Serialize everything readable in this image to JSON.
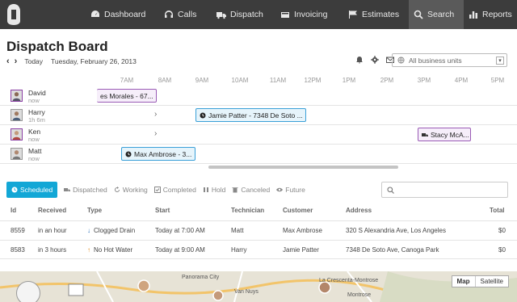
{
  "nav": {
    "items": [
      {
        "label": "Dashboard",
        "icon": "dashboard-icon"
      },
      {
        "label": "Calls",
        "icon": "headset-icon"
      },
      {
        "label": "Dispatch",
        "icon": "truck-icon"
      },
      {
        "label": "Invoicing",
        "icon": "invoice-icon"
      },
      {
        "label": "Estimates",
        "icon": "flag-icon"
      },
      {
        "label": "Search",
        "icon": "search-icon"
      },
      {
        "label": "Reports",
        "icon": "reports-icon"
      }
    ],
    "active": "Search"
  },
  "page": {
    "title": "Dispatch Board",
    "today_label": "Today",
    "date": "Tuesday, February 26, 2013",
    "business_units_placeholder": "All business units"
  },
  "timeline": {
    "hours": [
      "7AM",
      "8AM",
      "9AM",
      "10AM",
      "11AM",
      "12PM",
      "1PM",
      "2PM",
      "3PM",
      "4PM",
      "5PM"
    ],
    "technicians": [
      {
        "name": "David",
        "sub": "now",
        "selected": true,
        "jobs": [
          {
            "text": "es Morales - 67...",
            "color": "purple"
          }
        ]
      },
      {
        "name": "Harry",
        "sub": "1h 6m",
        "selected": false,
        "jobs": [
          {
            "text": "Jamie Patter - 7348 De Soto ...",
            "color": "blue"
          }
        ]
      },
      {
        "name": "Ken",
        "sub": "now",
        "selected": true,
        "jobs": [
          {
            "text": "Stacy McA...",
            "color": "purple"
          }
        ]
      },
      {
        "name": "Matt",
        "sub": "now",
        "selected": false,
        "jobs": [
          {
            "text": "Max Ambrose - 3...",
            "color": "blue"
          }
        ]
      }
    ]
  },
  "filters": [
    "Scheduled",
    "Dispatched",
    "Working",
    "Completed",
    "Hold",
    "Canceled",
    "Future"
  ],
  "active_filter": "Scheduled",
  "table": {
    "headers": [
      "Id",
      "Received",
      "Type",
      "Start",
      "Technician",
      "Customer",
      "Address",
      "Total"
    ],
    "rows": [
      [
        "8559",
        "in an hour",
        "Clogged Drain",
        "Today at 7:00 AM",
        "Matt",
        "Max Ambrose",
        "320 S Alexandria Ave, Los Angeles",
        "$0"
      ],
      [
        "8583",
        "in 3 hours",
        "No Hot Water",
        "Today at 9:00 AM",
        "Harry",
        "Jamie Patter",
        "7348 De Soto Ave, Canoga Park",
        "$0"
      ]
    ],
    "type_markers": [
      "↓",
      "↑"
    ],
    "type_marker_colors": [
      "#2a6fb8",
      "#e08a1e"
    ]
  },
  "map": {
    "buttons": [
      "Map",
      "Satellite"
    ],
    "labels": [
      "Panorama City",
      "Van Nuys",
      "La Crescenta-Montrose",
      "Montrose"
    ]
  },
  "colors": {
    "nav_bg": "#3c3c3c",
    "accent": "#12a7d6",
    "selected_border": "#8a3fa3",
    "job_blue": "#3aa0d8",
    "job_purple": "#9a5bb5"
  }
}
